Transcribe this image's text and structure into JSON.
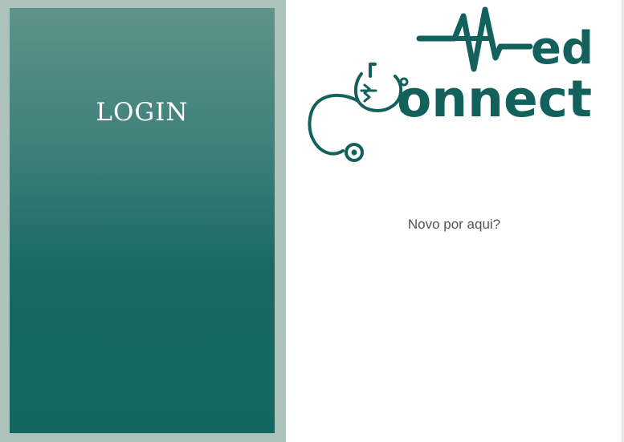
{
  "left_panel": {
    "title": "LOGIN"
  },
  "logo": {
    "word_top": "ed",
    "word_bottom": "onnect",
    "alt": "MedConnect"
  },
  "right_panel": {
    "signup_prompt": "Novo por aqui?"
  },
  "colors": {
    "brand_teal": "#12615d",
    "panel_frame": "#adc2ba"
  }
}
